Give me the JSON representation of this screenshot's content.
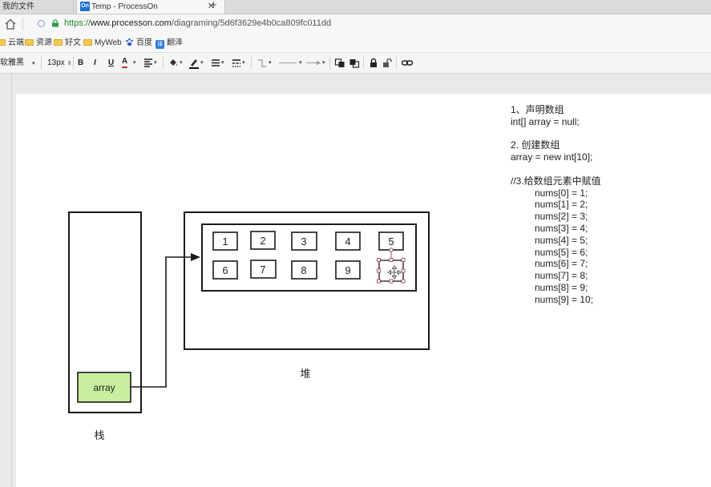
{
  "browser": {
    "tabs": [
      {
        "label": "我的文件"
      },
      {
        "label": "Temp - ProcessOn",
        "favicon": "On"
      }
    ],
    "address": {
      "scheme": "https://",
      "host": "www.processon.com",
      "path": "/diagraming/5d6f3629e4b0ca809fc011dd"
    },
    "bookmarks": [
      {
        "label": "云端",
        "icon": "folder-icon"
      },
      {
        "label": "资源",
        "icon": "folder-icon"
      },
      {
        "label": "好文",
        "icon": "folder-icon"
      },
      {
        "label": "MyWeb",
        "icon": "folder-icon"
      },
      {
        "label": "百度",
        "icon": "baidu-paw-icon"
      },
      {
        "label": "翻泽",
        "icon": "translate-icon",
        "badge": "译"
      }
    ]
  },
  "toolbar": {
    "font_family": "软雅黑",
    "font_size": "13px",
    "bold": "B",
    "italic": "I",
    "underline": "U",
    "font_color": "A"
  },
  "diagram": {
    "stack_label": "栈",
    "heap_label": "堆",
    "array_label": "array",
    "cells_row1": [
      "1",
      "2",
      "3",
      "4",
      "5"
    ],
    "cells_row2": [
      "6",
      "7",
      "8",
      "9",
      ""
    ],
    "array_fill": "#c7ef9e"
  },
  "notes": [
    {
      "text": "1、声明数组",
      "indent": false
    },
    {
      "text": "int[] array = null;",
      "indent": false
    },
    {
      "text": "",
      "indent": false
    },
    {
      "text": "2. 创建数组",
      "indent": false
    },
    {
      "text": "array = new int[10];",
      "indent": false
    },
    {
      "text": "",
      "indent": false
    },
    {
      "text": "//3.给数组元素中赋值",
      "indent": false
    },
    {
      "text": "nums[0] = 1;",
      "indent": true
    },
    {
      "text": "nums[1] = 2;",
      "indent": true
    },
    {
      "text": "nums[2] = 3;",
      "indent": true
    },
    {
      "text": "nums[3] = 4;",
      "indent": true
    },
    {
      "text": "nums[4] = 5;",
      "indent": true
    },
    {
      "text": "nums[5] = 6;",
      "indent": true
    },
    {
      "text": "nums[6] = 7;",
      "indent": true
    },
    {
      "text": "nums[7] = 8;",
      "indent": true
    },
    {
      "text": "nums[8] = 9;",
      "indent": true
    },
    {
      "text": "nums[9] = 10;",
      "indent": true
    }
  ]
}
